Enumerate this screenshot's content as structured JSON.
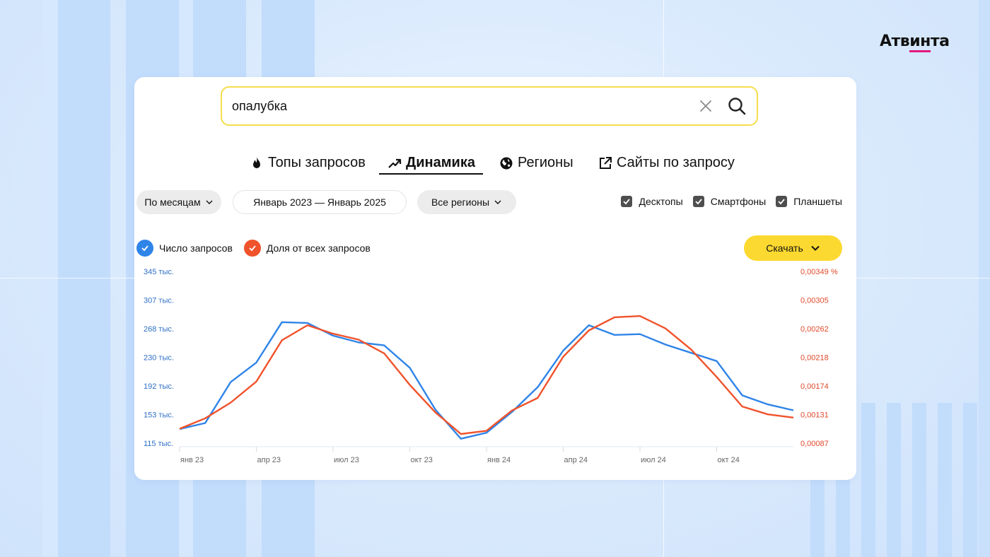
{
  "brand": {
    "logo_pre": "Атв",
    "logo_accent": "ин",
    "logo_post": "та",
    "accent_color": "#e5187e"
  },
  "search": {
    "value": "опалубка",
    "clear_icon": "close-icon",
    "search_icon": "search-icon"
  },
  "tabs": [
    {
      "label": "Топы запросов",
      "icon": "fire-icon",
      "active": false
    },
    {
      "label": "Динамика",
      "icon": "trend-up-icon",
      "active": true
    },
    {
      "label": "Регионы",
      "icon": "globe-icon",
      "active": false
    },
    {
      "label": "Сайты по запросу",
      "icon": "external-link-icon",
      "active": false
    }
  ],
  "filters": {
    "period_group": "По месяцам",
    "date_range": "Январь 2023 — Январь 2025",
    "regions": "Все регионы"
  },
  "devices": [
    {
      "label": "Десктопы",
      "checked": true
    },
    {
      "label": "Смартфоны",
      "checked": true
    },
    {
      "label": "Планшеты",
      "checked": true
    }
  ],
  "legend": [
    {
      "label": "Число запросов",
      "color": "#2f84e8"
    },
    {
      "label": "Доля от всех запросов",
      "color": "#f0522b"
    }
  ],
  "download_label": "Скачать",
  "chart_data": {
    "type": "line",
    "x": [
      "янв 23",
      "фев 23",
      "мар 23",
      "апр 23",
      "май 23",
      "июн 23",
      "июл 23",
      "авг 23",
      "сен 23",
      "окт 23",
      "ноя 23",
      "дек 23",
      "янв 24",
      "фев 24",
      "мар 24",
      "апр 24",
      "май 24",
      "июн 24",
      "июл 24",
      "авг 24",
      "сен 24",
      "окт 24",
      "ноя 24",
      "дек 24",
      "янв 25"
    ],
    "x_tick_labels": [
      "янв 23",
      "апр 23",
      "июл 23",
      "окт 23",
      "янв 24",
      "апр 24",
      "июл 24",
      "окт 24"
    ],
    "y_left_ticks": [
      "345 тыс.",
      "307 тыс.",
      "268 тыс.",
      "230 тыс.",
      "192 тыс.",
      "153 тыс.",
      "115 тыс."
    ],
    "y_right_ticks": [
      "0,00349 %",
      "0,00305",
      "0,00262",
      "0,00218",
      "0,00174",
      "0,00131",
      "0,00087"
    ],
    "y_left_lim": [
      115000,
      345000
    ],
    "y_right_lim": [
      0.00087,
      0.00349
    ],
    "series": [
      {
        "name": "Число запросов",
        "axis": "left",
        "color": "#2f84e8",
        "values": [
          134000,
          142000,
          197000,
          223000,
          277000,
          276000,
          259000,
          250000,
          246000,
          216000,
          160000,
          121000,
          129000,
          157000,
          190000,
          239000,
          273000,
          260000,
          261000,
          247000,
          236000,
          225000,
          179000,
          167000,
          159000
        ]
      },
      {
        "name": "Доля от всех запросов",
        "axis": "right",
        "color": "#f0522b",
        "values": [
          0.00109,
          0.00125,
          0.00149,
          0.00181,
          0.00244,
          0.00267,
          0.00254,
          0.00245,
          0.00224,
          0.00176,
          0.00134,
          0.00101,
          0.00106,
          0.00137,
          0.00156,
          0.00219,
          0.00259,
          0.00279,
          0.00281,
          0.00262,
          0.0023,
          0.00188,
          0.00143,
          0.00131,
          0.00126
        ]
      }
    ]
  }
}
